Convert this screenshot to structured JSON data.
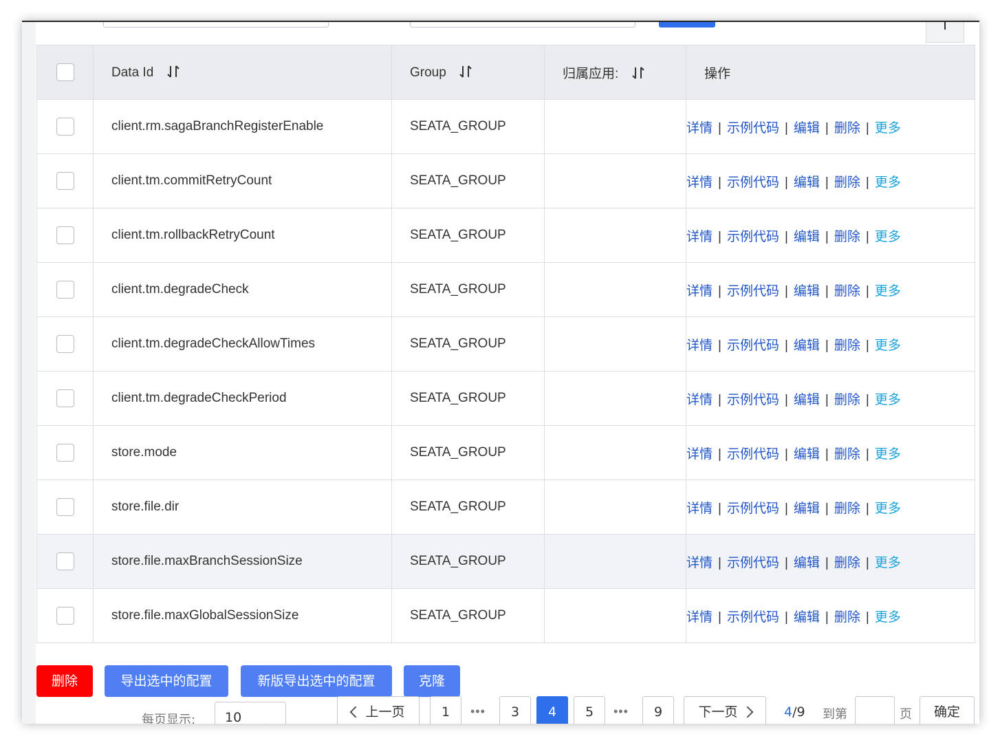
{
  "table": {
    "headers": {
      "data_id": "Data Id",
      "group": "Group",
      "app": "归属应用:",
      "ops": "操作"
    },
    "rows": [
      {
        "data_id": "client.rm.sagaBranchRegisterEnable",
        "group": "SEATA_GROUP",
        "app": ""
      },
      {
        "data_id": "client.tm.commitRetryCount",
        "group": "SEATA_GROUP",
        "app": ""
      },
      {
        "data_id": "client.tm.rollbackRetryCount",
        "group": "SEATA_GROUP",
        "app": ""
      },
      {
        "data_id": "client.tm.degradeCheck",
        "group": "SEATA_GROUP",
        "app": ""
      },
      {
        "data_id": "client.tm.degradeCheckAllowTimes",
        "group": "SEATA_GROUP",
        "app": ""
      },
      {
        "data_id": "client.tm.degradeCheckPeriod",
        "group": "SEATA_GROUP",
        "app": ""
      },
      {
        "data_id": "store.mode",
        "group": "SEATA_GROUP",
        "app": ""
      },
      {
        "data_id": "store.file.dir",
        "group": "SEATA_GROUP",
        "app": ""
      },
      {
        "data_id": "store.file.maxBranchSessionSize",
        "group": "SEATA_GROUP",
        "app": ""
      },
      {
        "data_id": "store.file.maxGlobalSessionSize",
        "group": "SEATA_GROUP",
        "app": ""
      }
    ],
    "row_actions": {
      "detail": "详情",
      "sample_code": "示例代码",
      "edit": "编辑",
      "delete": "删除",
      "more": "更多",
      "separator": "|"
    }
  },
  "actions": {
    "delete": "删除",
    "export_selected": "导出选中的配置",
    "export_selected_new": "新版导出选中的配置",
    "clone": "克隆"
  },
  "pagination": {
    "page_size_label": "每页显示:",
    "page_size": "10",
    "prev": "上一页",
    "next": "下一页",
    "pages": [
      "1",
      "3",
      "4",
      "5",
      "9"
    ],
    "ellipsis": "•••",
    "current": "4",
    "total_text": "/9",
    "goto_label": "到第",
    "goto_value": "",
    "page_unit": "页",
    "confirm": "确定"
  },
  "colors": {
    "primary": "#2d6fe8",
    "danger": "#ff0000",
    "link": "#2155c9",
    "link_more": "#1aa3dd",
    "header_bg": "#ebecf0"
  }
}
